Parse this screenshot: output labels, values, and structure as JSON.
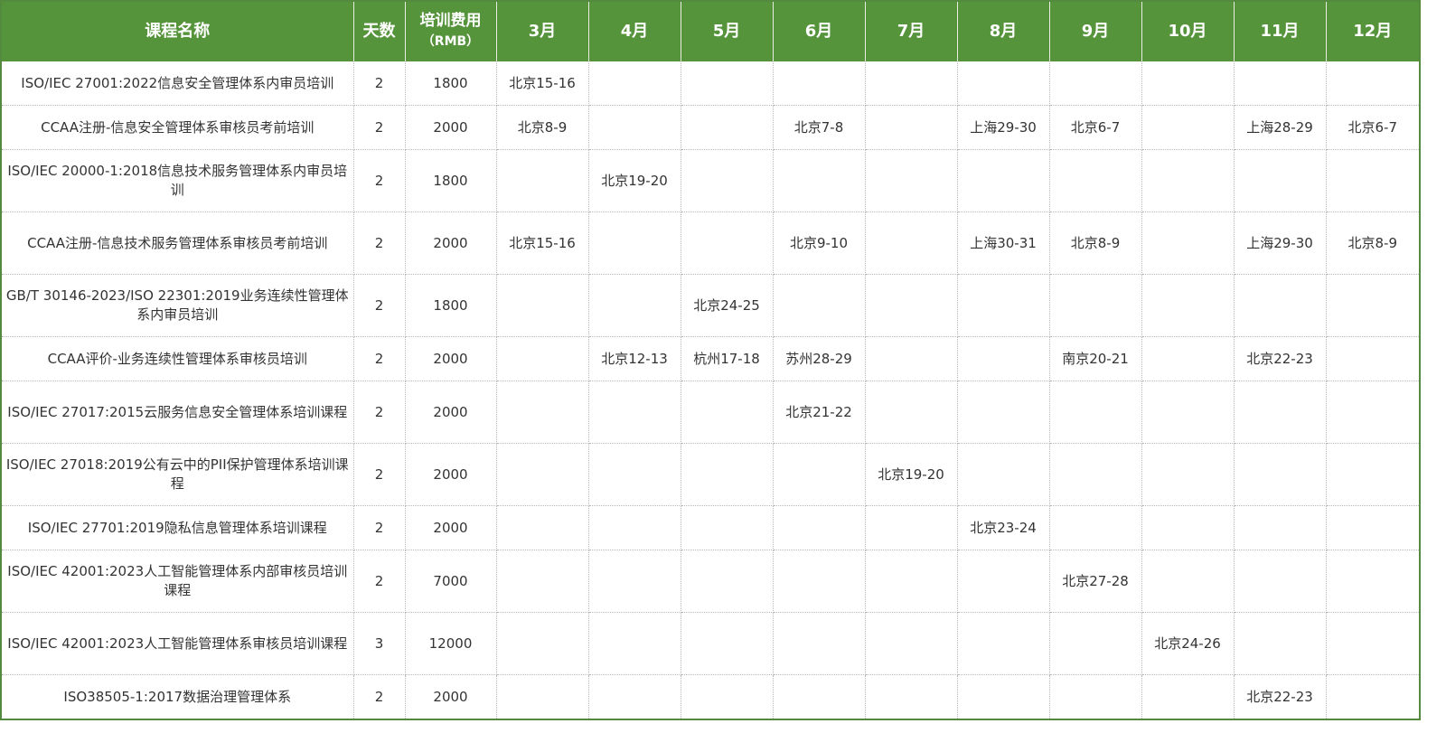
{
  "headers": {
    "course": "课程名称",
    "days": "天数",
    "fee_line1": "培训费用",
    "fee_line2": "（RMB）",
    "months": [
      "3月",
      "4月",
      "5月",
      "6月",
      "7月",
      "8月",
      "9月",
      "10月",
      "11月",
      "12月"
    ]
  },
  "colors": {
    "header_bg": "#56943c",
    "header_text": "#ffffff",
    "outer_border": "#548a3d",
    "cell_text": "#333333"
  },
  "rows": [
    {
      "course": "ISO/IEC 27001:2022信息安全管理体系内审员培训",
      "days": "2",
      "fee": "1800",
      "months": [
        "北京15-16",
        "",
        "",
        "",
        "",
        "",
        "",
        "",
        "",
        ""
      ]
    },
    {
      "course": "CCAA注册-信息安全管理体系审核员考前培训",
      "days": "2",
      "fee": "2000",
      "months": [
        "北京8-9",
        "",
        "",
        "北京7-8",
        "",
        "上海29-30",
        "北京6-7",
        "",
        "上海28-29",
        "北京6-7"
      ]
    },
    {
      "course": "ISO/IEC 20000-1:2018信息技术服务管理体系内审员培训",
      "days": "2",
      "fee": "1800",
      "months": [
        "",
        "北京19-20",
        "",
        "",
        "",
        "",
        "",
        "",
        "",
        ""
      ]
    },
    {
      "course": "CCAA注册-信息技术服务管理体系审核员考前培训",
      "days": "2",
      "fee": "2000",
      "months": [
        "北京15-16",
        "",
        "",
        "北京9-10",
        "",
        "上海30-31",
        "北京8-9",
        "",
        "上海29-30",
        "北京8-9"
      ]
    },
    {
      "course": "GB/T 30146-2023/ISO 22301:2019业务连续性管理体系内审员培训",
      "days": "2",
      "fee": "1800",
      "months": [
        "",
        "",
        "北京24-25",
        "",
        "",
        "",
        "",
        "",
        "",
        ""
      ]
    },
    {
      "course": "CCAA评价-业务连续性管理体系审核员培训",
      "days": "2",
      "fee": "2000",
      "months": [
        "",
        "北京12-13",
        "杭州17-18",
        "苏州28-29",
        "",
        "",
        "南京20-21",
        "",
        "北京22-23",
        ""
      ]
    },
    {
      "course": "ISO/IEC 27017:2015云服务信息安全管理体系培训课程",
      "days": "2",
      "fee": "2000",
      "months": [
        "",
        "",
        "",
        "北京21-22",
        "",
        "",
        "",
        "",
        "",
        ""
      ]
    },
    {
      "course": "ISO/IEC 27018:2019公有云中的PII保护管理体系培训课程",
      "days": "2",
      "fee": "2000",
      "months": [
        "",
        "",
        "",
        "",
        "北京19-20",
        "",
        "",
        "",
        "",
        ""
      ]
    },
    {
      "course": "ISO/IEC 27701:2019隐私信息管理体系培训课程",
      "days": "2",
      "fee": "2000",
      "months": [
        "",
        "",
        "",
        "",
        "",
        "北京23-24",
        "",
        "",
        "",
        ""
      ]
    },
    {
      "course": "ISO/IEC 42001:2023人工智能管理体系内部审核员培训课程",
      "days": "2",
      "fee": "7000",
      "months": [
        "",
        "",
        "",
        "",
        "",
        "",
        "北京27-28",
        "",
        "",
        ""
      ]
    },
    {
      "course": "ISO/IEC 42001:2023人工智能管理体系审核员培训课程",
      "days": "3",
      "fee": "12000",
      "months": [
        "",
        "",
        "",
        "",
        "",
        "",
        "",
        "北京24-26",
        "",
        ""
      ]
    },
    {
      "course": "ISO38505-1:2017数据治理管理体系",
      "days": "2",
      "fee": "2000",
      "months": [
        "",
        "",
        "",
        "",
        "",
        "",
        "",
        "",
        "北京22-23",
        ""
      ]
    }
  ]
}
